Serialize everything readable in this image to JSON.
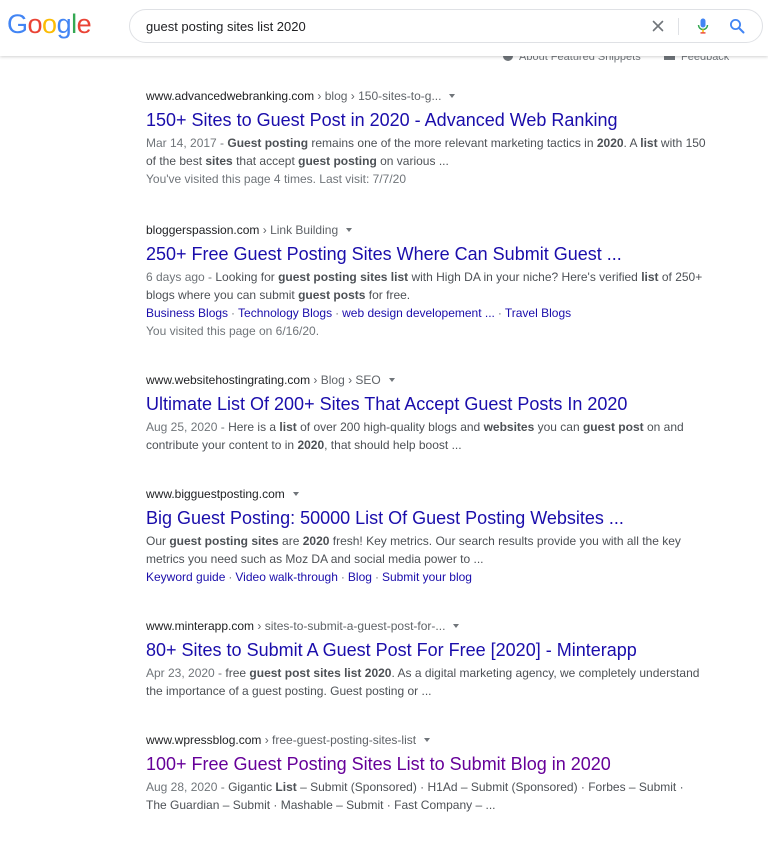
{
  "brand": {
    "logo_letters": [
      "G",
      "o",
      "o",
      "g",
      "l",
      "e"
    ],
    "logo_colors": [
      "#4285F4",
      "#EA4335",
      "#FBBC05",
      "#4285F4",
      "#34A853",
      "#EA4335"
    ]
  },
  "search": {
    "query": "guest posting sites list 2020",
    "clear_icon": "close-icon",
    "mic_icon": "microphone-icon",
    "search_icon": "search-icon"
  },
  "header_links": {
    "featured_snippets": "About Featured Snippets",
    "feedback": "Feedback"
  },
  "colors": {
    "link": "#1a0dab",
    "visited_link": "#660099",
    "snippet": "#4d5156",
    "meta": "#70757a"
  },
  "results": [
    {
      "domain": "www.advancedwebranking.com",
      "path": " › blog › 150-sites-to-g...",
      "title": "150+ Sites to Guest Post in 2020 - Advanced Web Ranking",
      "visited": false,
      "date": "Mar 14, 2017",
      "snippet_html": "<b>Guest posting</b> remains one of the more relevant marketing tactics in <b>2020</b>. A <b>list</b> with 150 of the best <b>sites</b> that accept <b>guest posting</b> on various ...",
      "visit_note": "You've visited this page 4 times. Last visit: 7/7/20",
      "sitelinks": []
    },
    {
      "domain": "bloggerspassion.com",
      "path": " › Link Building",
      "title": "250+ Free Guest Posting Sites Where Can Submit Guest ...",
      "visited": false,
      "date": "6 days ago",
      "snippet_html": "Looking for <b>guest posting sites list</b> with High DA in your niche? Here's verified <b>list</b> of 250+ blogs where you can submit <b>guest posts</b> for free.",
      "visit_note": "You visited this page on 6/16/20.",
      "sitelinks": [
        "Business Blogs",
        "Technology Blogs",
        "web design developement ...",
        "Travel Blogs"
      ]
    },
    {
      "domain": "www.websitehostingrating.com",
      "path": " › Blog › SEO",
      "title": "Ultimate List Of 200+ Sites That Accept Guest Posts In 2020",
      "visited": false,
      "date": "Aug 25, 2020",
      "snippet_html": "Here is a <b>list</b> of over 200 high-quality blogs and <b>websites</b> you can <b>guest post</b> on and contribute your content to in <b>2020</b>, that should help boost ...",
      "visit_note": "",
      "sitelinks": []
    },
    {
      "domain": "www.bigguestposting.com",
      "path": "",
      "title": "Big Guest Posting: 50000 List Of Guest Posting Websites ...",
      "visited": false,
      "date": "",
      "snippet_html": "Our <b>guest posting sites</b> are <b>2020</b> fresh! Key metrics. Our search results provide you with all the key metrics you need such as Moz DA and social media power to ...",
      "visit_note": "",
      "sitelinks": [
        "Keyword guide",
        "Video walk-through",
        "Blog",
        "Submit your blog"
      ]
    },
    {
      "domain": "www.minterapp.com",
      "path": " › sites-to-submit-a-guest-post-for-...",
      "title": "80+ Sites to Submit A Guest Post For Free [2020] - Minterapp",
      "visited": false,
      "date": "Apr 23, 2020",
      "snippet_html": "free <b>guest post sites list 2020</b>. As a digital marketing agency, we completely understand the importance of a guest posting. Guest posting or ...",
      "visit_note": "",
      "sitelinks": []
    },
    {
      "domain": "www.wpressblog.com",
      "path": " › free-guest-posting-sites-list",
      "title": "100+ Free Guest Posting Sites List to Submit Blog in 2020",
      "visited": true,
      "date": "Aug 28, 2020",
      "snippet_html": "Gigantic <b>List</b> – Submit (Sponsored) · H1Ad – Submit (Sponsored) · Forbes – Submit · The Guardian – Submit · Mashable – Submit · Fast Company – ...",
      "visit_note": "",
      "sitelinks": []
    }
  ]
}
